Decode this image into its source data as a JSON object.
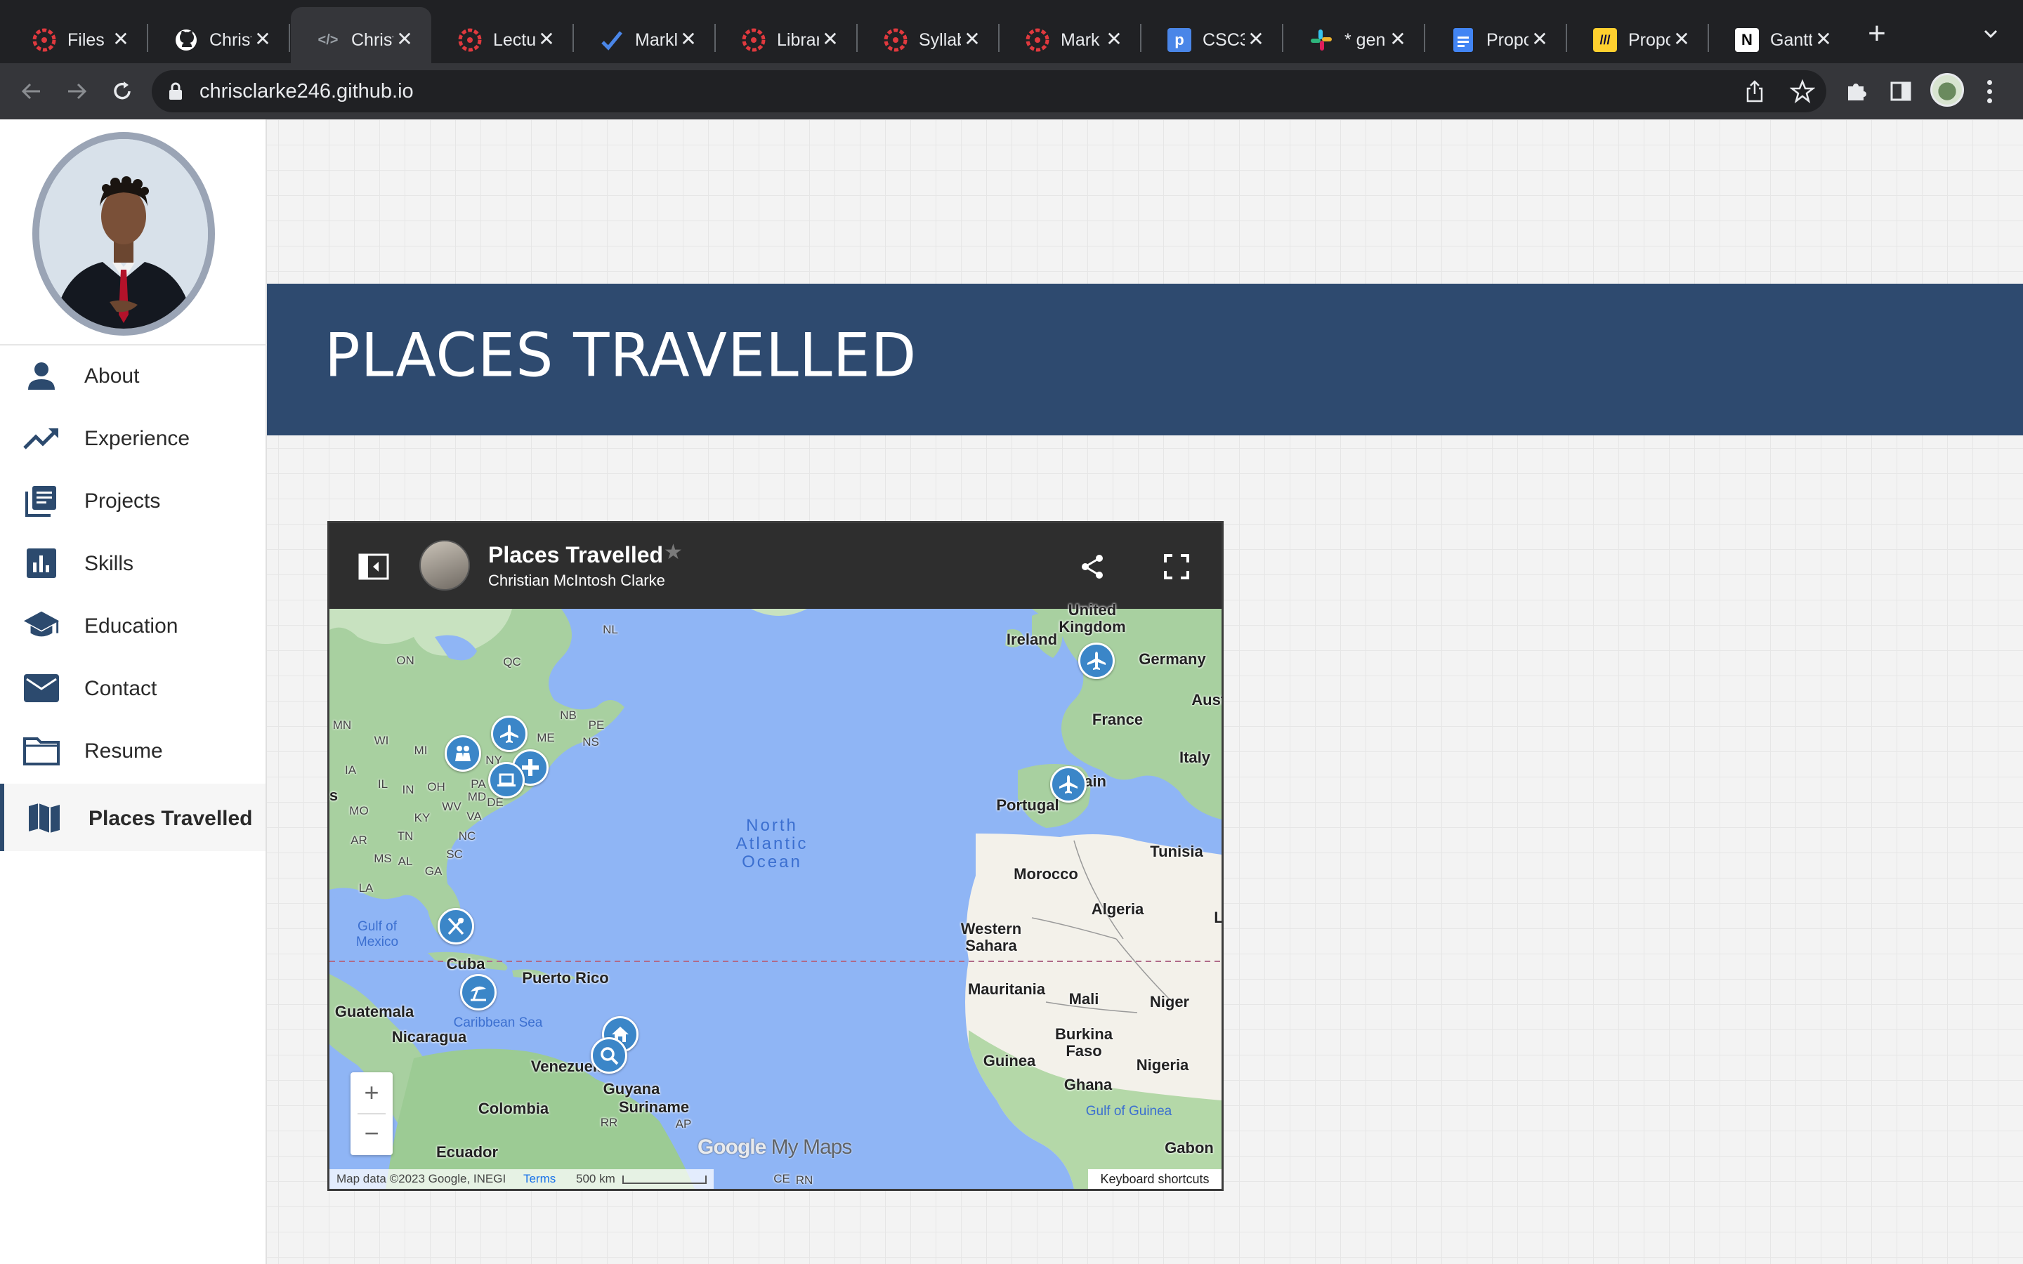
{
  "browser": {
    "tabs": [
      {
        "title": "Files",
        "icon": "canvas-icon",
        "color": "#e0393e",
        "active": false
      },
      {
        "title": "Christ",
        "icon": "github-icon",
        "color": "#ffffff",
        "active": false
      },
      {
        "title": "Christ",
        "icon": "code-icon",
        "color": "#9aa0a6",
        "active": true
      },
      {
        "title": "Lectu",
        "icon": "canvas-icon",
        "color": "#e0393e",
        "active": false
      },
      {
        "title": "Markl",
        "icon": "checkmark-icon",
        "color": "#4a86e8",
        "active": false
      },
      {
        "title": "Librar",
        "icon": "canvas-icon",
        "color": "#e0393e",
        "active": false
      },
      {
        "title": "Syllab",
        "icon": "canvas-icon",
        "color": "#e0393e",
        "active": false
      },
      {
        "title": "Mark",
        "icon": "canvas-icon",
        "color": "#e0393e",
        "active": false
      },
      {
        "title": "CSC3",
        "icon": "p-icon",
        "color": "#4a86e8",
        "active": false
      },
      {
        "title": "* gen",
        "icon": "slack-icon",
        "color": "#e01e5a",
        "active": false
      },
      {
        "title": "Propo",
        "icon": "docs-icon",
        "color": "#4285f4",
        "active": false
      },
      {
        "title": "Propo",
        "icon": "miro-icon",
        "color": "#ffd02f",
        "active": false
      },
      {
        "title": "Gantt",
        "icon": "notion-icon",
        "color": "#ffffff",
        "active": false
      }
    ],
    "new_tab": "+",
    "url": "chrisclarke246.github.io"
  },
  "sidebar": {
    "items": [
      {
        "label": "About",
        "icon": "person-icon"
      },
      {
        "label": "Experience",
        "icon": "trending-up-icon"
      },
      {
        "label": "Projects",
        "icon": "library-books-icon"
      },
      {
        "label": "Skills",
        "icon": "bar-chart-icon"
      },
      {
        "label": "Education",
        "icon": "school-icon"
      },
      {
        "label": "Contact",
        "icon": "mail-icon"
      },
      {
        "label": "Resume",
        "icon": "folder-icon"
      },
      {
        "label": "Places Travelled",
        "icon": "map-icon",
        "active": true
      }
    ]
  },
  "banner": {
    "title": "PLACES TRAVELLED"
  },
  "map": {
    "title": "Places Travelled",
    "author": "Christian McIntosh Clarke",
    "star": "★",
    "zoom_in": "+",
    "zoom_out": "−",
    "logo": {
      "google": "Google",
      "mymaps": " My Maps"
    },
    "attribution": "Map data ©2023 Google, INEGI",
    "terms": "Terms",
    "scale": "500 km",
    "keyboard": "Keyboard shortcuts",
    "labels": {
      "nl": "NL",
      "on": "ON",
      "qc": "QC",
      "nb": "NB",
      "pe": "PE",
      "ns": "NS",
      "me": "ME",
      "mn": "MN",
      "wi": "WI",
      "mi": "MI",
      "ny": "NY",
      "ia": "IA",
      "il": "IL",
      "in": "IN",
      "oh": "OH",
      "pa": "PA",
      "md": "MD",
      "de": "DE",
      "wv": "WV",
      "va": "VA",
      "mo": "MO",
      "ky": "KY",
      "ar": "AR",
      "tn": "TN",
      "nc": "NC",
      "sc": "SC",
      "ms": "MS",
      "al": "AL",
      "la": "LA",
      "s": "s",
      "ga": "GA",
      "gulf_mexico": "Gulf of Mexico",
      "ocean": "North Atlantic Ocean",
      "ireland": "Ireland",
      "uk": "United Kingdom",
      "germany": "Germany",
      "austria": "Austr",
      "france": "France",
      "italy": "Italy",
      "spain": "Spain",
      "portugal": "Portugal",
      "tunisia": "Tunisia",
      "morocco": "Morocco",
      "algeria": "Algeria",
      "libya": "L",
      "western_sahara": "Western Sahara",
      "mauritania": "Mauritania",
      "mali": "Mali",
      "niger": "Niger",
      "burkina": "Burkina Faso",
      "guinea": "Guinea",
      "ghana": "Ghana",
      "nigeria": "Nigeria",
      "gulf_guinea": "Gulf of Guinea",
      "gabon": "Gabon",
      "cuba": "Cuba",
      "puerto_rico": "Puerto Rico",
      "guatemala": "Guatemala",
      "nicaragua": "Nicaragua",
      "caribbean": "Caribbean Sea",
      "venezuela": "Venezuela",
      "guyana": "Guyana",
      "suriname": "Suriname",
      "colombia": "Colombia",
      "ecuador": "Ecuador",
      "rr": "RR",
      "ap": "AP",
      "ce": "CE",
      "rn": "RN"
    },
    "pins": [
      {
        "name": "pin-new-york-people",
        "icon": "people-icon"
      },
      {
        "name": "pin-boston-flight",
        "icon": "plane-icon"
      },
      {
        "name": "pin-hospital",
        "icon": "plus-icon"
      },
      {
        "name": "pin-dc-work",
        "icon": "laptop-icon"
      },
      {
        "name": "pin-florida-food",
        "icon": "utensils-icon"
      },
      {
        "name": "pin-jamaica-beach",
        "icon": "beach-icon"
      },
      {
        "name": "pin-barbados-home",
        "icon": "home-icon"
      },
      {
        "name": "pin-trinidad-search",
        "icon": "search-icon"
      },
      {
        "name": "pin-london-flight",
        "icon": "plane-icon"
      },
      {
        "name": "pin-spain-flight",
        "icon": "plane-icon"
      }
    ]
  }
}
